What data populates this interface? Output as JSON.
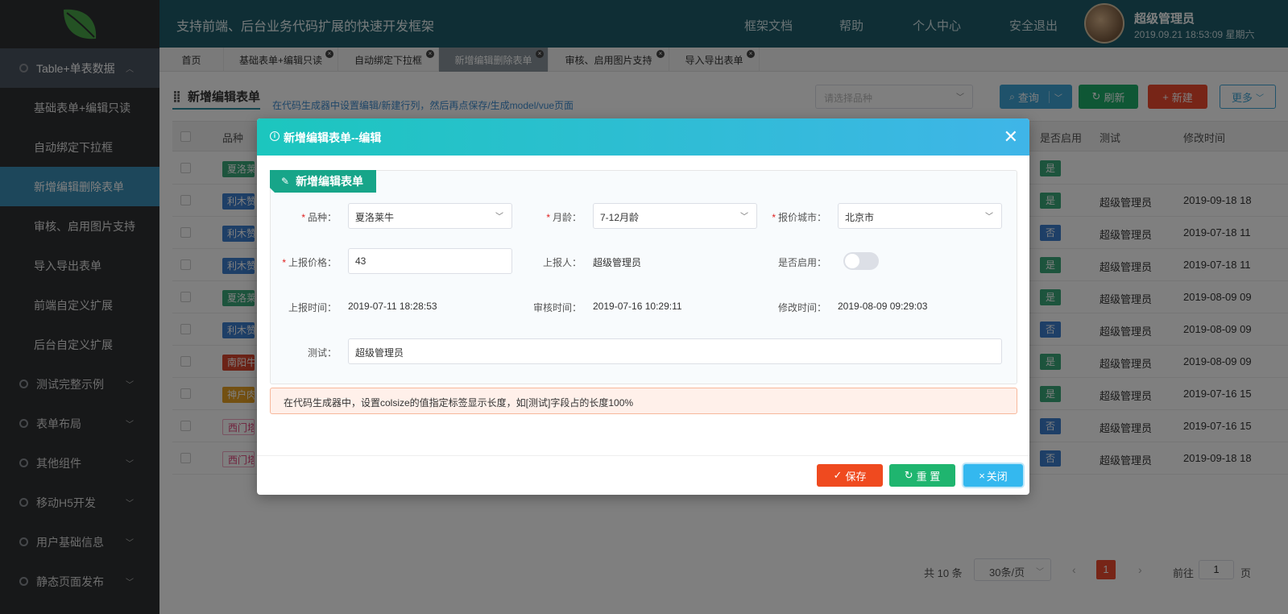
{
  "header": {
    "title": "支持前端、后台业务代码扩展的快速开发框架",
    "nav": [
      "框架文档",
      "帮助",
      "个人中心",
      "安全退出"
    ],
    "user": "超级管理员",
    "datetime": "2019.09.21 18:53:09 星期六"
  },
  "sidebar": {
    "open_group": "Table+单表数据",
    "open_items": [
      "基础表单+编辑只读",
      "自动绑定下拉框",
      "新增编辑删除表单",
      "审核、启用图片支持",
      "导入导出表单",
      "前端自定义扩展",
      "后台自定义扩展"
    ],
    "groups": [
      "测试完整示例",
      "表单布局",
      "其他组件",
      "移动H5开发",
      "用户基础信息",
      "静态页面发布"
    ]
  },
  "tabs": [
    "首页",
    "基础表单+编辑只读",
    "自动绑定下拉框",
    "新增编辑删除表单",
    "审核、启用图片支持",
    "导入导出表单"
  ],
  "page": {
    "heading": "新增编辑表单",
    "hint": "在代码生成器中设置编辑/新建行列，然后再点保存/生成model/vue页面",
    "breed_placeholder": "请选择品种",
    "btn_query": "查询",
    "btn_refresh": "刷新",
    "btn_add": "新建",
    "btn_more": "更多"
  },
  "table": {
    "headers": {
      "breed": "品种",
      "enable": "是否启用",
      "tester": "测试",
      "mtime": "修改时间"
    },
    "rows": [
      {
        "breed": "夏洛莱",
        "enable": "是",
        "tester": "",
        "mtime": ""
      },
      {
        "breed": "利木赞",
        "enable": "是",
        "tester": "超级管理员",
        "mtime": "2019-09-18 18"
      },
      {
        "breed": "利木赞",
        "enable": "否",
        "tester": "超级管理员",
        "mtime": "2019-07-18 11"
      },
      {
        "breed": "利木赞",
        "enable": "是",
        "tester": "超级管理员",
        "mtime": "2019-07-18 11"
      },
      {
        "breed": "夏洛莱",
        "enable": "是",
        "tester": "超级管理员",
        "mtime": "2019-08-09 09"
      },
      {
        "breed": "利木赞",
        "enable": "否",
        "tester": "超级管理员",
        "mtime": "2019-08-09 09"
      },
      {
        "breed": "南阳牛",
        "enable": "是",
        "tester": "超级管理员",
        "mtime": "2019-08-09 09"
      },
      {
        "breed": "神户肉",
        "enable": "是",
        "tester": "超级管理员",
        "mtime": "2019-07-16 15"
      },
      {
        "breed": "西门塔",
        "enable": "否",
        "tester": "超级管理员",
        "mtime": "2019-07-16 15"
      },
      {
        "breed": "西门塔",
        "enable": "否",
        "tester": "超级管理员",
        "mtime": "2019-09-18 18"
      }
    ],
    "colors": {
      "breed": [
        "#3aa87a",
        "#3d7fcf",
        "#3d7fcf",
        "#3d7fcf",
        "#3aa87a",
        "#3d7fcf",
        "#d8472f",
        "#e6a124",
        "#ffffff",
        "#ffffff"
      ],
      "enable_yes": "#3aa87a",
      "enable_no": "#3d7fcf"
    }
  },
  "pager": {
    "total": "共 10 条",
    "page_size": "30条/页",
    "current": "1",
    "goto_prefix": "前往",
    "goto_value": "1",
    "goto_suffix": "页"
  },
  "modal": {
    "title": "新增编辑表单--编辑",
    "section": "新增编辑表单",
    "fields": {
      "breed_label": "品种：",
      "breed_value": "夏洛莱牛",
      "age_label": "月龄：",
      "age_value": "7-12月龄",
      "city_label": "报价城市：",
      "city_value": "北京市",
      "price_label": "上报价格：",
      "price_value": "43",
      "reporter_label": "上报人：",
      "reporter_value": "超级管理员",
      "enabled_label": "是否启用：",
      "report_time_label": "上报时间：",
      "report_time_value": "2019-07-11 18:28:53",
      "audit_time_label": "审核时间：",
      "audit_time_value": "2019-07-16 10:29:11",
      "modify_time_label": "修改时间：",
      "modify_time_value": "2019-08-09 09:29:03",
      "test_label": "测试：",
      "test_value": "超级管理员"
    },
    "notice": "在代码生成器中，设置colsize的值指定标签显示长度，如[测试]字段占的长度100%",
    "btn_save": "保存",
    "btn_reset": "重 置",
    "btn_close": "关闭"
  },
  "colors": {
    "header": "#1f5d6a",
    "sidebar": "#2f3133",
    "sidebar_active": "#3a8fb7",
    "query": "#3fa5d6",
    "refresh": "#1fae6a",
    "add": "#ef4a2f",
    "save": "#ef4a1f",
    "reset": "#1fb56f",
    "close": "#34b8ef"
  }
}
